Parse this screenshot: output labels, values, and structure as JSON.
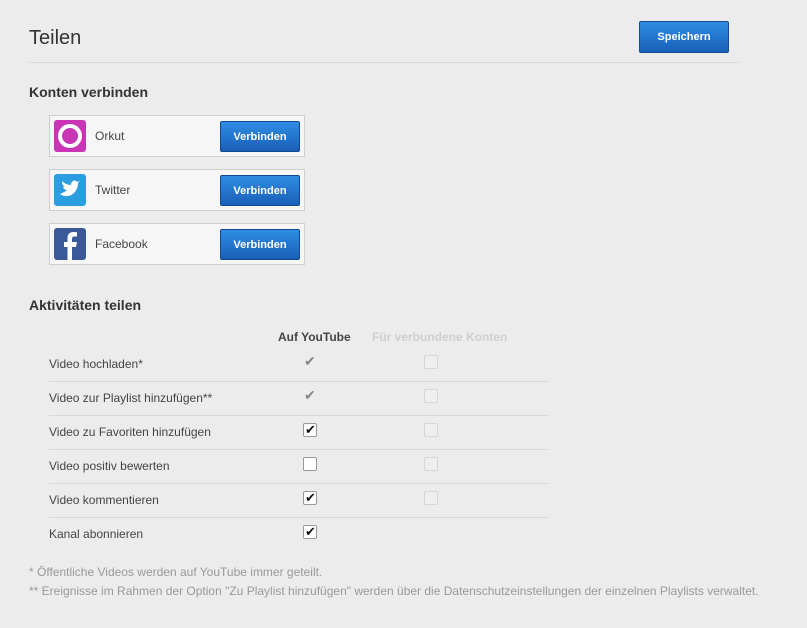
{
  "header": {
    "title": "Teilen",
    "save_label": "Speichern"
  },
  "connect": {
    "title": "Konten verbinden",
    "accounts": [
      {
        "name": "Orkut",
        "button": "Verbinden",
        "icon": "orkut-icon",
        "color": "#c836b6"
      },
      {
        "name": "Twitter",
        "button": "Verbinden",
        "icon": "twitter-icon",
        "color": "#2c9de0"
      },
      {
        "name": "Facebook",
        "button": "Verbinden",
        "icon": "facebook-icon",
        "color": "#3b5998"
      }
    ]
  },
  "activities": {
    "title": "Aktivitäten teilen",
    "col_youtube": "Auf YouTube",
    "col_connected": "Für verbundene Konten",
    "rows": [
      {
        "label": "Video hochladen*",
        "youtube": "fixed",
        "connected": "disabled"
      },
      {
        "label": "Video zur Playlist hinzufügen**",
        "youtube": "fixed",
        "connected": "disabled"
      },
      {
        "label": "Video zu Favoriten hinzufügen",
        "youtube": "checked",
        "connected": "disabled"
      },
      {
        "label": "Video positiv bewerten",
        "youtube": "unchecked",
        "connected": "disabled"
      },
      {
        "label": "Video kommentieren",
        "youtube": "checked",
        "connected": "disabled"
      },
      {
        "label": "Kanal abonnieren",
        "youtube": "checked",
        "connected": "none"
      }
    ]
  },
  "footnotes": {
    "note1": "* Öffentliche Videos werden auf YouTube immer geteilt.",
    "note2": "** Ereignisse im Rahmen der Option \"Zu Playlist hinzufügen\" werden über die Datenschutzeinstellungen der einzelnen Playlists verwaltet."
  }
}
